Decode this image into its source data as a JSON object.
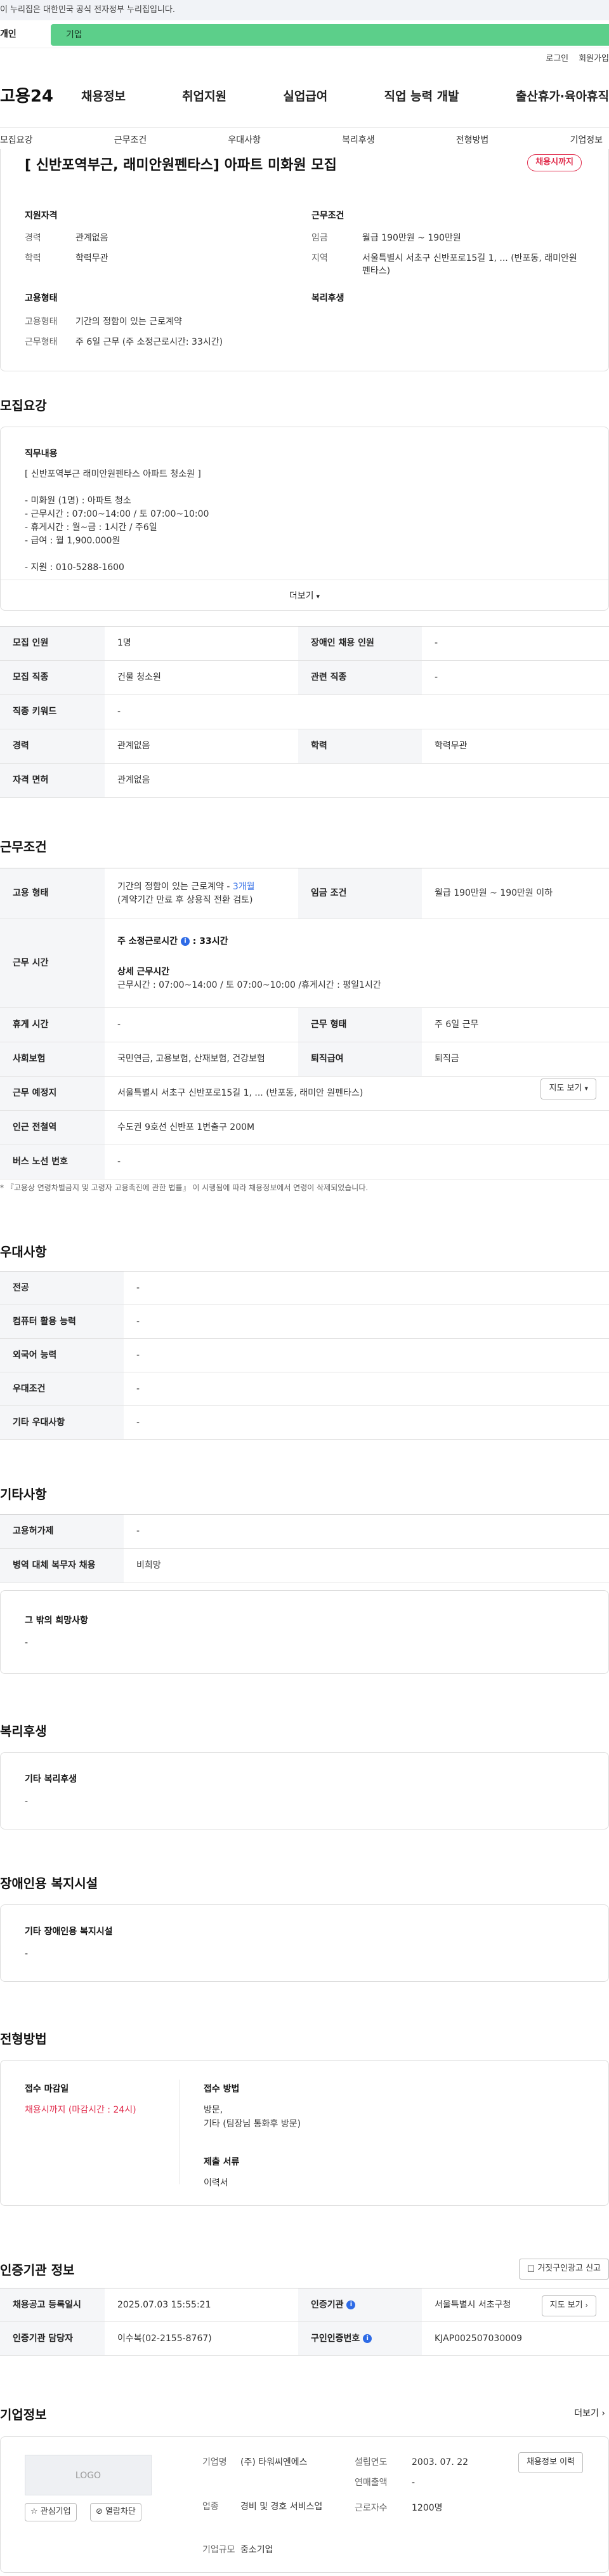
{
  "gov_bar": "이 누리집은 대한민국 공식 전자정부 누리집입니다.",
  "tabs": {
    "individual": "개인",
    "enterprise": "기업"
  },
  "util_links": [
    "로그인",
    "회원가입"
  ],
  "logo": "고용24",
  "gnb": [
    "채용정보",
    "취업지원",
    "실업급여",
    "직업 능력 개발",
    "출산휴가·육아휴직"
  ],
  "subnav": [
    "모집요강",
    "근무조건",
    "우대사항",
    "복리후생",
    "전형방법",
    "기업정보"
  ],
  "job": {
    "title": "[ 신반포역부근, 래미안원펜타스] 아파트 미화원 모집",
    "badge": "채용시까지",
    "qual_heading": "지원자격",
    "exp_label": "경력",
    "exp_value": "관계없음",
    "edu_label": "학력",
    "edu_value": "학력무관",
    "cond_heading": "근무조건",
    "wage_label": "임금",
    "wage_value": "월급 190만원 ~ 190만원",
    "region_label": "지역",
    "region_value": "서울특별시 서초구 신반포로15길 1, ... (반포동, 래미안원펜타스)",
    "emp_heading": "고용형태",
    "emptype_label": "고용형태",
    "emptype_value": "기간의 정함이 있는 근로계약",
    "worktype_label": "근무형태",
    "worktype_value": "주 6일 근무 (주 소정근로시간: 33시간)",
    "welfare_heading": "복리후생"
  },
  "recruit": {
    "title": "모집요강",
    "duty_heading": "직무내용",
    "duty_lines": [
      "[ 신반포역부근  래미안원펜타스 아파트 청소원 ]",
      "",
      "- 미화원 (1명) : 아파트 청소",
      "- 근무시간 : 07:00~14:00 / 토 07:00~10:00",
      "- 휴게시간 : 월~금 : 1시간 / 주6일",
      "- 급여 : 월 1,900.000원",
      "",
      "- 지원 : 010-5288-1600"
    ],
    "more": "더보기",
    "rows": [
      {
        "k1": "모집 인원",
        "v1": "1명",
        "k2": "장애인 채용 인원",
        "v2": "-"
      },
      {
        "k1": "모집 직종",
        "v1": "건물 청소원",
        "k2": "관련 직종",
        "v2": "-"
      },
      {
        "k1": "직종 키워드",
        "v1": "-"
      },
      {
        "k1": "경력",
        "v1": "관계없음",
        "k2": "학력",
        "v2": "학력무관"
      },
      {
        "k1": "자격 면허",
        "v1": "관계없음"
      }
    ]
  },
  "work": {
    "title": "근무조건",
    "emp_type_k": "고용 형태",
    "emp_type_v1": "기간의 정함이 있는 근로계약 - ",
    "emp_type_months": "3개월",
    "emp_type_v2": "(계약기간 만료 후 상용직 전환 검토)",
    "wage_k": "임금 조건",
    "wage_v": "월급 190만원 ~ 190만원 이하",
    "hours_k": "근무 시간",
    "hours_week": "주 소정근로시간",
    "hours_week_v": ": 33시간",
    "hours_detail_head": "상세 근무시간",
    "hours_detail": "근무시간 : 07:00~14:00 / 토 07:00~10:00 /휴게시간 :  평일1시간",
    "break_k": "휴게 시간",
    "break_v": "-",
    "shape_k": "근무 형태",
    "shape_v": "주 6일 근무",
    "ins_k": "사회보험",
    "ins_v": "국민연금, 고용보험, 산재보험, 건강보험",
    "sev_k": "퇴직급여",
    "sev_v": "퇴직금",
    "place_k": "근무 예정지",
    "place_v": "서울특별시 서초구 신반포로15길 1, ... (반포동, 래미안 원펜타스)",
    "map_btn": "지도 보기",
    "subway_k": "인근 전철역",
    "subway_v": "수도권 9호선 신반포 1번출구 200M",
    "bus_k": "버스 노선 번호",
    "bus_v": "-",
    "note": "* 『고용상 연령차별금지 및 고령자 고용촉진에 관한 법률』 이 시행됨에 따라 채용정보에서 연령이 삭제되었습니다."
  },
  "pref": {
    "title": "우대사항",
    "rows": [
      {
        "k": "전공",
        "v": "-"
      },
      {
        "k": "컴퓨터 활용 능력",
        "v": "-"
      },
      {
        "k": "외국어 능력",
        "v": "-"
      },
      {
        "k": "우대조건",
        "v": "-"
      },
      {
        "k": "기타 우대사항",
        "v": "-"
      }
    ]
  },
  "etc": {
    "title": "기타사항",
    "rows": [
      {
        "k": "고용허가제",
        "v": "-"
      },
      {
        "k": "병역 대체 복무자 채용",
        "v": "비희망"
      }
    ],
    "other_heading": "그 밖의 희망사항",
    "other_value": "-"
  },
  "welfare": {
    "title": "복리후생",
    "heading": "기타 복리후생",
    "value": "-"
  },
  "disab": {
    "title": "장애인용 복지시설",
    "heading": "기타 장애인용 복지시설",
    "value": "-"
  },
  "screen": {
    "title": "전형방법",
    "deadline_heading": "접수 마감일",
    "deadline_value": "채용시까지 (마감시간 : 24시)",
    "method_heading": "접수 방법",
    "method_line1": "방문,",
    "method_line2": "기타 (팀장님 통화후 방문)",
    "docs_heading": "제출 서류",
    "docs_value": "이력서"
  },
  "cert": {
    "title": "인증기관 정보",
    "report_btn": "거짓구인광고 신고",
    "reg_k": "채용공고 등록일시",
    "reg_v": "2025.07.03 15:55:21",
    "org_k": "인증기관",
    "org_v": "서울특별시 서초구청",
    "map_btn": "지도 보기",
    "mgr_k": "인증기관 담당자",
    "mgr_v": "이수복(02-2155-8767)",
    "num_k": "구인인증번호",
    "num_v": "KJAP002507030009"
  },
  "company": {
    "title": "기업정보",
    "more": "더보기",
    "logo_text": "LOGO",
    "interest_btn": "관심기업",
    "block_btn": "열람차단",
    "name_k": "기업명",
    "name_v": "(주) 타워씨엔에스",
    "founded_k": "설립연도",
    "founded_v": "2003. 07. 22",
    "sales_k": "연매출액",
    "sales_v": "-",
    "industry_k": "업종",
    "industry_v": "경비 및 경호 서비스업",
    "staff_k": "근로자수",
    "staff_v": "1200명",
    "size_k": "기업규모",
    "size_v": "중소기업",
    "recruit_btn": "채용정보 이력"
  }
}
